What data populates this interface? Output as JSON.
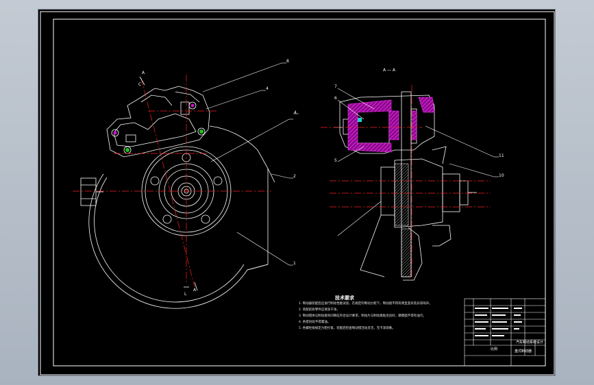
{
  "section_view": {
    "title": "A — A"
  },
  "section_marks": {
    "a_top": "A",
    "a_bottom": "A",
    "c_mark": "C",
    "l_mark": "L"
  },
  "callouts_left": [
    "8",
    "4",
    "4",
    "2",
    "1"
  ],
  "callouts_right": [
    "7",
    "6",
    "5",
    "11",
    "10"
  ],
  "technical_notes": {
    "title": "技术要求",
    "lines": [
      "1. 制动器装配后应进行制动性能试验，在规定的制动力矩下，制动盘不得有明显变形及异常响声。",
      "2. 装配前各零件应清洗干净。",
      "3. 制动钳体与制动盘的间隙应符合设计要求，制动片与制动盘贴合良好，摩擦面不得有油污。",
      "4. 各密封处不得漏油。",
      "5. 各螺栓按规定力矩拧紧，装配后检查制动钳活动灵活，无卡滞现象。"
    ]
  },
  "title_block": {
    "drawing_name": "盘式制动器",
    "scale_label": "比例",
    "company": "汽车制动系统设计"
  },
  "colors": {
    "line": "#ffffff",
    "centerline": "#ff2020",
    "hatch_magenta": "#d010d0",
    "accent_cyan": "#20d0d0",
    "accent_green": "#20c020"
  }
}
